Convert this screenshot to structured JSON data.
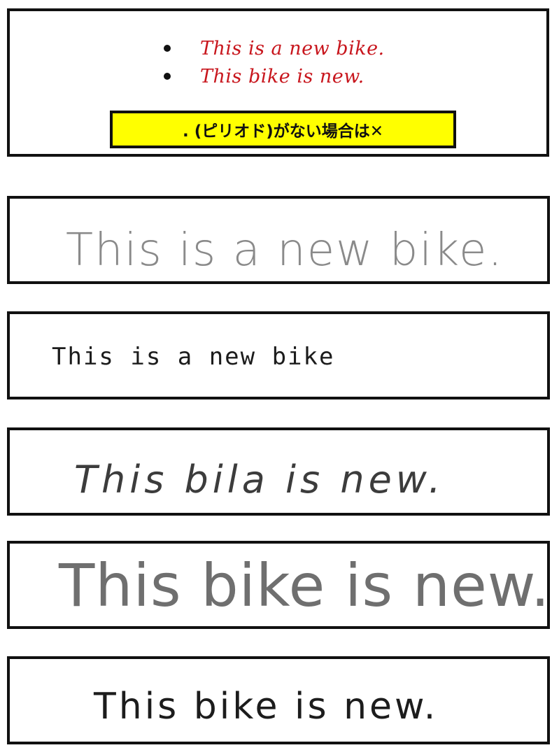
{
  "model_answers": [
    "This is a new bike.",
    "This bike is new."
  ],
  "rule_note": ". (ピリオド)がない場合は✕",
  "student_answers": [
    "This is a new bike.",
    "This is a new bike",
    "This bila is new.",
    "This bike is new.",
    "This bike is new."
  ],
  "colors": {
    "model_text": "#c8161d",
    "banner_background": "#ffff00",
    "border": "#111111"
  }
}
